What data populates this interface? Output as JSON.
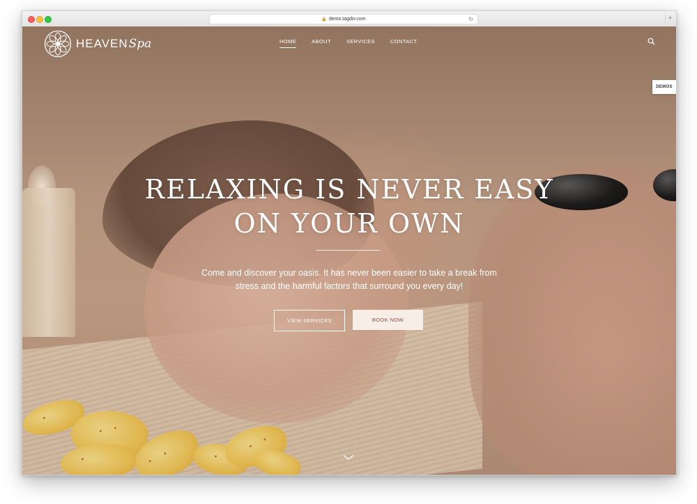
{
  "browser": {
    "url": "demo.tagdiv.com",
    "new_tab_symbol": "+"
  },
  "site": {
    "logo": {
      "word": "HEAVEN",
      "script": "Spa"
    },
    "nav": {
      "items": [
        {
          "label": "HOME",
          "active": true
        },
        {
          "label": "ABOUT",
          "active": false
        },
        {
          "label": "SERVICES",
          "active": false
        },
        {
          "label": "CONTACT",
          "active": false
        }
      ]
    },
    "demos_label": "DEMOS"
  },
  "hero": {
    "headline_line1": "RELAXING IS NEVER EASY",
    "headline_line2": "ON YOUR OWN",
    "subtext_line1": "Come and discover your oasis. It has never been easier to take a break from",
    "subtext_line2": "stress and the harmful factors that surround you every day!",
    "primary_button": "VIEW SERVICES",
    "secondary_button": "BOOK NOW"
  },
  "colors": {
    "accent_button_text": "#8a4f43",
    "accent_button_bg": "#f8eee8"
  },
  "icons": [
    "lock-icon",
    "reload-icon",
    "lotus-logo-icon",
    "search-icon",
    "chevron-down-icon"
  ]
}
